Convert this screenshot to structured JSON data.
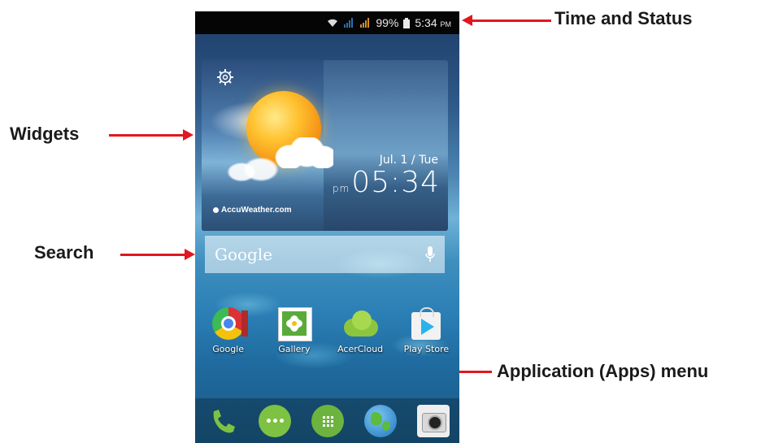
{
  "status": {
    "battery_percent": "99%",
    "time": "5:34",
    "ampm": "PM"
  },
  "widget": {
    "brand": "AccuWeather.com",
    "date": "Jul. 1 / Tue",
    "ampm": "pm",
    "time": "05:34"
  },
  "search": {
    "brand": "Google"
  },
  "apps": [
    {
      "label": "Google"
    },
    {
      "label": "Gallery"
    },
    {
      "label": "AcerCloud"
    },
    {
      "label": "Play Store"
    }
  ],
  "callouts": {
    "time_status": "Time and Status",
    "widgets": "Widgets",
    "search": "Search",
    "apps_menu": "Application (Apps) menu"
  },
  "colors": {
    "arrow": "#e0181f",
    "statusbar": "#050505"
  },
  "dock": [
    "phone-icon",
    "messages-icon",
    "apps-menu-icon",
    "browser-icon",
    "camera-icon"
  ]
}
